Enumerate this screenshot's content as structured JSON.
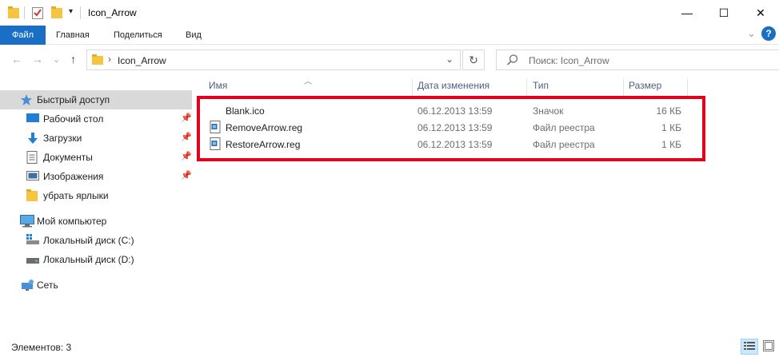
{
  "window": {
    "title": "Icon_Arrow",
    "minimize_glyph": "—",
    "maximize_glyph": "☐",
    "close_glyph": "✕"
  },
  "ribbon": {
    "tabs": [
      {
        "label": "Файл"
      },
      {
        "label": "Главная"
      },
      {
        "label": "Поделиться"
      },
      {
        "label": "Вид"
      }
    ],
    "help_glyph": "?",
    "collapse_glyph": "⌄"
  },
  "navigation": {
    "back_glyph": "←",
    "forward_glyph": "→",
    "recent_glyph": "⌄",
    "up_glyph": "↑"
  },
  "address": {
    "path": "Icon_Arrow",
    "separator": "›",
    "dropdown_glyph": "⌄",
    "refresh_glyph": "↻"
  },
  "search": {
    "placeholder": "Поиск: Icon_Arrow"
  },
  "sidebar": {
    "items": [
      {
        "label": "Быстрый доступ",
        "icon": "star-icon",
        "pinned": false,
        "selected": true
      },
      {
        "label": "Рабочий стол",
        "icon": "desktop-icon",
        "pinned": true
      },
      {
        "label": "Загрузки",
        "icon": "download-icon",
        "pinned": true
      },
      {
        "label": "Документы",
        "icon": "documents-icon",
        "pinned": true
      },
      {
        "label": "Изображения",
        "icon": "pictures-icon",
        "pinned": true
      },
      {
        "label": "убрать ярлыки",
        "icon": "folder-icon",
        "pinned": false
      },
      {
        "label": "Мой компьютер",
        "icon": "computer-icon",
        "pinned": false
      },
      {
        "label": "Локальный диск (C:)",
        "icon": "windows-drive-icon",
        "pinned": false
      },
      {
        "label": "Локальный диск (D:)",
        "icon": "drive-icon",
        "pinned": false
      },
      {
        "label": "Сеть",
        "icon": "network-icon",
        "pinned": false
      }
    ]
  },
  "columns": {
    "name": "Имя",
    "date": "Дата изменения",
    "type": "Тип",
    "size": "Размер"
  },
  "files": [
    {
      "name": "Blank.ico",
      "date": "06.12.2013 13:59",
      "type": "Значок",
      "size": "16 КБ",
      "icon": "blank-icon"
    },
    {
      "name": "RemoveArrow.reg",
      "date": "06.12.2013 13:59",
      "type": "Файл реестра",
      "size": "1 КБ",
      "icon": "registry-file-icon"
    },
    {
      "name": "RestoreArrow.reg",
      "date": "06.12.2013 13:59",
      "type": "Файл реестра",
      "size": "1 КБ",
      "icon": "registry-file-icon"
    }
  ],
  "status": {
    "item_count": "Элементов: 3"
  },
  "colors": {
    "accent": "#1a6fc4",
    "highlight_border": "#e2001a",
    "folder": "#f5c542"
  }
}
